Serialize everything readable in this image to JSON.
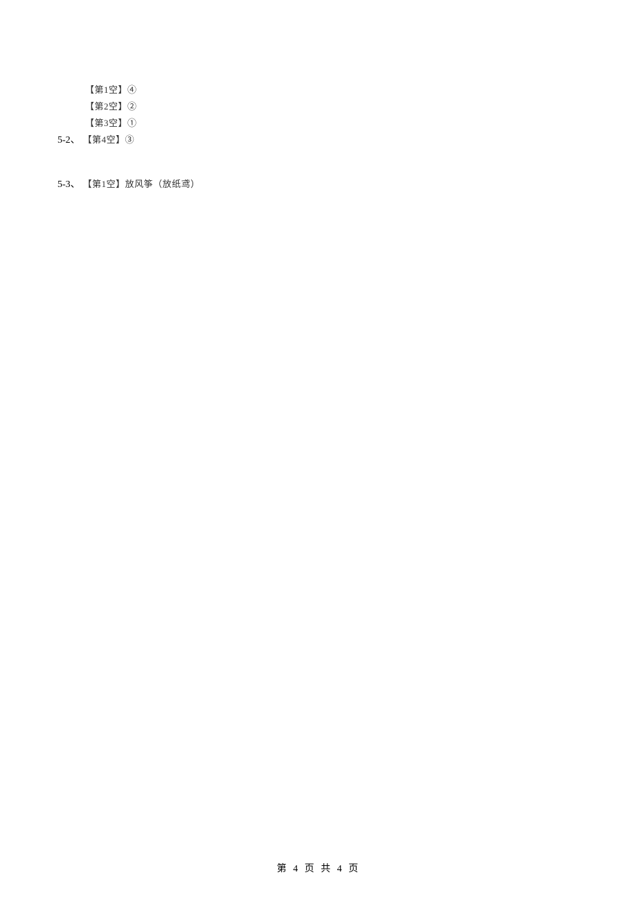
{
  "answers": {
    "line1": "【第1空】④",
    "line2": "【第2空】②",
    "line3": "【第3空】①",
    "q52_num": "5-2、",
    "q52_answer": "【第4空】③",
    "q53_num": "5-3、",
    "q53_answer": "【第1空】放风筝（放纸鸢）"
  },
  "footer": "第 4 页 共 4 页"
}
